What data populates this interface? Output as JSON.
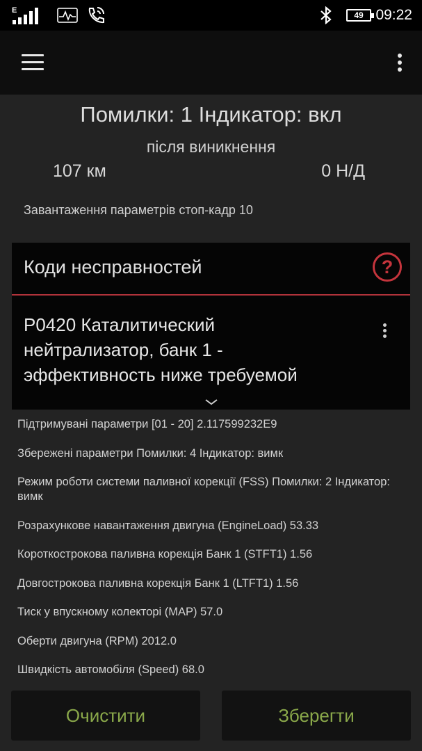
{
  "status_bar": {
    "signal_label": "E",
    "battery": "49",
    "time": "09:22",
    "icons": [
      "signal-icon",
      "pulse-icon",
      "wifi-call-icon",
      "bluetooth-icon",
      "battery-icon"
    ]
  },
  "app_bar": {
    "icons": [
      "hamburger-menu-icon",
      "overflow-menu-icon"
    ]
  },
  "summary": {
    "line1": "Помилки: 1 Індикатор: вкл",
    "line2": "після виникнення",
    "distance_left": "107 км",
    "distance_right": "0 Н/Д",
    "freeze_frame": "Завантаження параметрів стоп-кадр 10"
  },
  "codes_card": {
    "title": "Коди несправностей",
    "help_icon": "?",
    "dtc_line1": "P0420 Каталитический",
    "dtc_line2": "нейтрализатор, банк 1 -",
    "dtc_line3": "эффективность ниже требуемой"
  },
  "parameters": [
    "Підтримувані параметри [01 - 20] 2.117599232E9",
    "Збережені параметри Помилки: 4 Індикатор: вимк",
    "Режим роботи системи паливної корекції (FSS) Помилки: 2 Індикатор: вимк",
    "Розрахункове навантаження двигуна (EngineLoad) 53.33",
    "Короткострокова паливна корекція Банк 1 (STFT1) 1.56",
    "Довгострокова паливна корекція Банк 1 (LTFT1) 1.56",
    "Тиск у впускному колекторі (MAP) 57.0",
    "Оберти двигуна (RPM) 2012.0",
    "Швидкість автомобіля (Speed) 68.0"
  ],
  "buttons": {
    "clear": "Очистити",
    "save": "Зберегти"
  },
  "colors": {
    "accent_red": "#c4343c",
    "button_text": "#8aa84a",
    "background": "#232323"
  }
}
